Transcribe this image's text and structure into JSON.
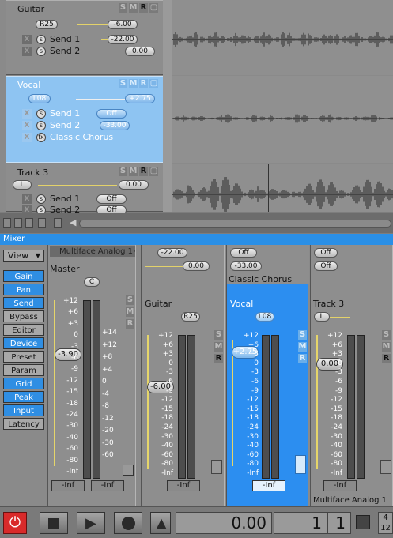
{
  "tracks": [
    {
      "name": "Guitar",
      "pan": "R25",
      "volume": "-6.00",
      "sends": [
        {
          "label": "Send 1",
          "value": "-22.00"
        },
        {
          "label": "Send 2",
          "value": "0.00"
        }
      ]
    },
    {
      "name": "Vocal",
      "pan": "L08",
      "volume": "+2.75",
      "sends": [
        {
          "label": "Send 1",
          "value": "Off"
        },
        {
          "label": "Send 2",
          "value": "-33.00"
        }
      ],
      "fx": "Classic Chorus"
    },
    {
      "name": "Track 3",
      "pan": "L",
      "volume": "0.00",
      "sends": [
        {
          "label": "Send 1",
          "value": "Off"
        },
        {
          "label": "Send 2",
          "value": "Off"
        }
      ]
    }
  ],
  "smr": {
    "s": "S",
    "m": "M",
    "r": "R"
  },
  "icons": {
    "x": "X",
    "s": "s",
    "fx": "fx"
  },
  "mixer": {
    "title": "Mixer",
    "view_label": "View",
    "side_buttons": [
      {
        "label": "Gain",
        "on": true
      },
      {
        "label": "Pan",
        "on": true
      },
      {
        "label": "Send",
        "on": true
      },
      {
        "label": "Bypass",
        "on": false
      },
      {
        "label": "Editor",
        "on": false
      },
      {
        "label": "Device",
        "on": true
      },
      {
        "label": "Preset",
        "on": false
      },
      {
        "label": "Param",
        "on": false
      },
      {
        "label": "Grid",
        "on": true
      },
      {
        "label": "Peak",
        "on": true
      },
      {
        "label": "Input",
        "on": true
      },
      {
        "label": "Latency",
        "on": false
      }
    ],
    "master": {
      "device": "Multiface Analog 1+",
      "name": "Master",
      "pan": "C",
      "volume": "-3.90",
      "peak_left": "-Inf",
      "peak_right": "-Inf"
    },
    "strips": [
      {
        "name": "Guitar",
        "send1": "-22.00",
        "send2": "0.00",
        "pan": "R25",
        "volume": "-6.00",
        "peak": "-Inf"
      },
      {
        "name": "Vocal",
        "send1": "Off",
        "send2": "-33.00",
        "insert": "Classic Chorus",
        "pan": "L08",
        "volume": "+2.75",
        "peak": "-Inf"
      },
      {
        "name": "Track 3",
        "send1": "Off",
        "send2": "Off",
        "pan": "L",
        "volume": "0.00",
        "peak": "-Inf",
        "output": "Multiface Analog 1"
      }
    ],
    "master_scale_left": [
      "+12",
      "+6",
      "+3",
      "0",
      "-3",
      "-6",
      "-9",
      "-12",
      "-15",
      "-18",
      "-24",
      "-30",
      "-40",
      "-60",
      "-80",
      "-Inf"
    ],
    "master_scale_right": [
      "+14",
      "+12",
      "+8",
      "+4",
      "0",
      "-4",
      "-8",
      "-12",
      "-20",
      "-30",
      "-60"
    ],
    "strip_scale": [
      "+12",
      "+6",
      "+3",
      "0",
      "-3",
      "-6",
      "-9",
      "-12",
      "-15",
      "-18",
      "-24",
      "-30",
      "-40",
      "-60",
      "-80",
      "-Inf"
    ]
  },
  "transport": {
    "time": "0.00",
    "bar": "1",
    "beat": "1",
    "sig_top": "4",
    "sig_bottom": "12"
  },
  "colors": {
    "accent": "#2c8ef0",
    "selected_track": "#8ec4f2",
    "record": "#d92a2a"
  }
}
